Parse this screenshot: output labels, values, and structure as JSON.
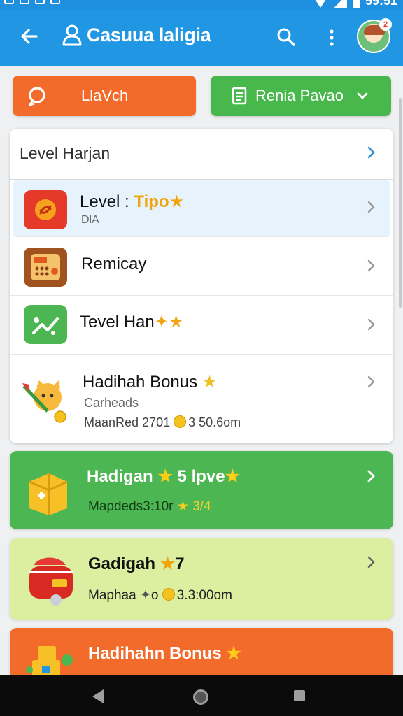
{
  "status_bar": {
    "time": "59:51"
  },
  "app_bar": {
    "title": "Casuua laligia",
    "avatar_badge": "2",
    "icons": [
      "back-arrow-icon",
      "user-icon",
      "search-icon",
      "more-vert-icon"
    ]
  },
  "actions": {
    "left_label": "LlaVch",
    "right_label": "Renia Pavao",
    "colors": {
      "left": "#f26b2a",
      "right": "#48b84d"
    }
  },
  "card": {
    "header": "Level Harjan",
    "rows": [
      {
        "label": "Level : ",
        "label_highlight": "Tipo",
        "sub": "DlA",
        "icon": "swirl-icon"
      },
      {
        "label": "Remicay",
        "icon": "calculator-icon"
      },
      {
        "label": "Tevel Han",
        "icon": "grow-chart-icon"
      },
      {
        "label": "Hadihah Bonus",
        "sub": "Carheads",
        "meta_prefix": "MaanRed 2701",
        "meta_value": "3 50.6om",
        "icon": "cat-arrow-icon"
      }
    ]
  },
  "bonus_cards": [
    {
      "title": "Hadigan",
      "title_suffix": "5 lpve",
      "sub_prefix": "Mapdeds",
      "sub_mid": "3:10r",
      "sub_value": "3/4",
      "color": "#4cb752",
      "icon": "gift-box-icon"
    },
    {
      "title": "Gadigah",
      "title_suffix": "7",
      "sub_prefix": "Maphaa",
      "sub_value": "3.3:00om",
      "color": "#dceea0",
      "icon": "red-bag-icon"
    },
    {
      "title": "Hadihahn Bonus",
      "color": "#f26b2a",
      "icon": "robot-blocks-icon"
    }
  ],
  "nav_bar": {
    "icons": [
      "nav-back-icon",
      "nav-home-icon",
      "nav-recent-icon"
    ]
  }
}
